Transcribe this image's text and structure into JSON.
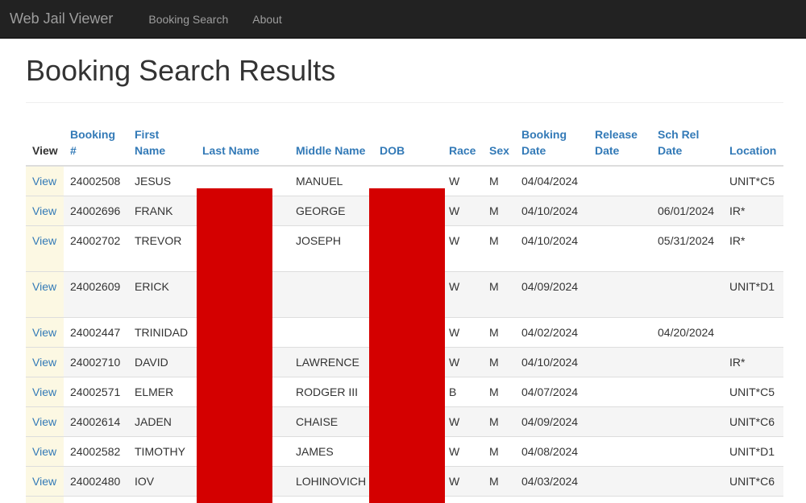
{
  "navbar": {
    "brand": "Web Jail Viewer",
    "links": [
      "Booking Search",
      "About"
    ]
  },
  "page_title": "Booking Search Results",
  "table": {
    "headers": [
      "View",
      "Booking #",
      "First Name",
      "Last Name",
      "Middle Name",
      "DOB",
      "Race",
      "Sex",
      "Booking Date",
      "Release Date",
      "Sch Rel Date",
      "Location"
    ],
    "view_label": "View",
    "rows": [
      {
        "booking": "24002508",
        "first": "JESUS",
        "middle": "MANUEL",
        "race": "W",
        "sex": "M",
        "booking_date": "04/04/2024",
        "release_date": "",
        "sch_rel_date": "",
        "location": "UNIT*C5"
      },
      {
        "booking": "24002696",
        "first": "FRANK",
        "middle": "GEORGE",
        "race": "W",
        "sex": "M",
        "booking_date": "04/10/2024",
        "release_date": "",
        "sch_rel_date": "06/01/2024",
        "location": "IR*"
      },
      {
        "booking": "24002702",
        "first": "TREVOR",
        "middle": "JOSEPH",
        "race": "W",
        "sex": "M",
        "booking_date": "04/10/2024",
        "release_date": "",
        "sch_rel_date": "05/31/2024",
        "location": "IR*"
      },
      {
        "booking": "24002609",
        "first": "ERICK",
        "middle": "",
        "race": "W",
        "sex": "M",
        "booking_date": "04/09/2024",
        "release_date": "",
        "sch_rel_date": "",
        "location": "UNIT*D1"
      },
      {
        "booking": "24002447",
        "first": "TRINIDAD",
        "middle": "",
        "race": "W",
        "sex": "M",
        "booking_date": "04/02/2024",
        "release_date": "",
        "sch_rel_date": "04/20/2024",
        "location": ""
      },
      {
        "booking": "24002710",
        "first": "DAVID",
        "middle": "LAWRENCE",
        "race": "W",
        "sex": "M",
        "booking_date": "04/10/2024",
        "release_date": "",
        "sch_rel_date": "",
        "location": "IR*"
      },
      {
        "booking": "24002571",
        "first": "ELMER",
        "middle": "RODGER III",
        "race": "B",
        "sex": "M",
        "booking_date": "04/07/2024",
        "release_date": "",
        "sch_rel_date": "",
        "location": "UNIT*C5"
      },
      {
        "booking": "24002614",
        "first": "JADEN",
        "middle": "CHAISE",
        "race": "W",
        "sex": "M",
        "booking_date": "04/09/2024",
        "release_date": "",
        "sch_rel_date": "",
        "location": "UNIT*C6"
      },
      {
        "booking": "24002582",
        "first": "TIMOTHY",
        "middle": "JAMES",
        "race": "W",
        "sex": "M",
        "booking_date": "04/08/2024",
        "release_date": "",
        "sch_rel_date": "",
        "location": "UNIT*D1"
      },
      {
        "booking": "24002480",
        "first": "IOV",
        "middle": "LOHINOVICH",
        "race": "W",
        "sex": "M",
        "booking_date": "04/03/2024",
        "release_date": "",
        "sch_rel_date": "",
        "location": "UNIT*C6"
      }
    ]
  },
  "colors": {
    "navbar": "#222222",
    "link": "#337ab7",
    "view_column": "#fcf8e3",
    "redaction": "#d40000"
  }
}
